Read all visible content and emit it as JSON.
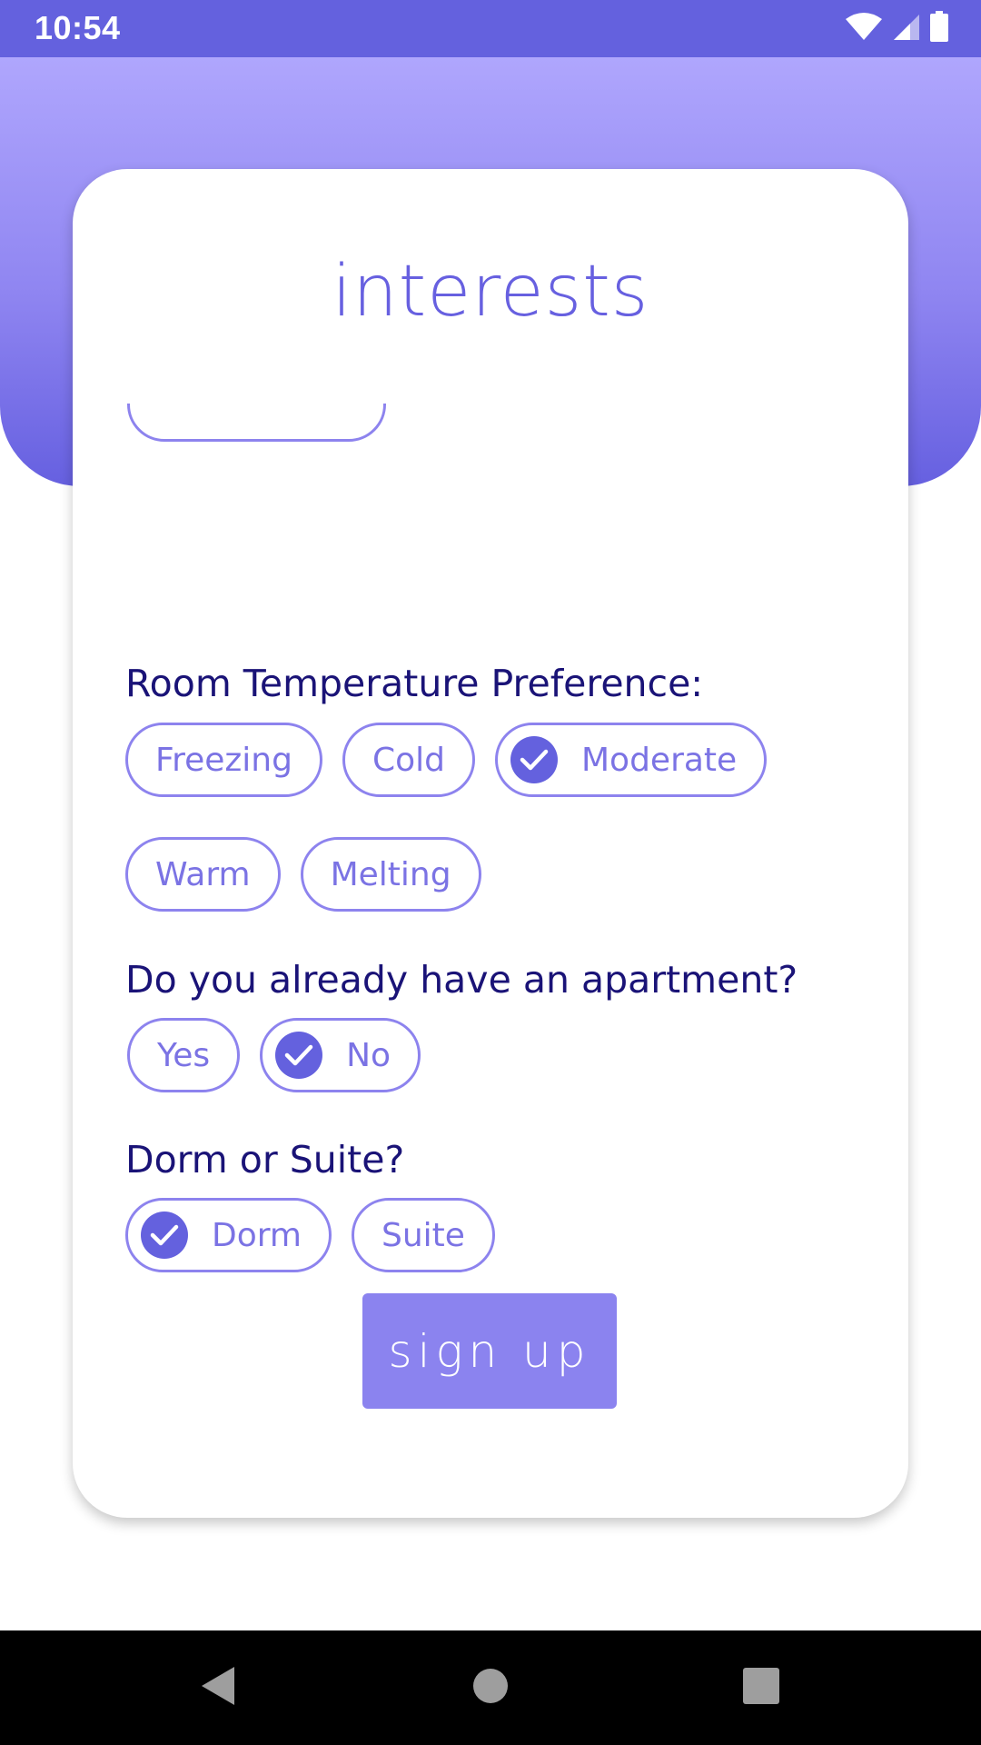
{
  "status_bar": {
    "time": "10:54",
    "icons": [
      "wifi-icon",
      "signal-icon",
      "battery-icon"
    ],
    "color": "#6461de"
  },
  "header": {
    "gradient_top": "#afa6fd",
    "gradient_bottom": "#6660e0"
  },
  "card": {
    "title": "interests"
  },
  "questions": [
    {
      "label": "Room Temperature Preference:",
      "options": [
        {
          "label": "Freezing",
          "selected": false
        },
        {
          "label": "Cold",
          "selected": false
        },
        {
          "label": "Moderate",
          "selected": true
        },
        {
          "label": "Warm",
          "selected": false
        },
        {
          "label": "Melting",
          "selected": false
        }
      ]
    },
    {
      "label": "Do you already have an apartment?",
      "options": [
        {
          "label": "Yes",
          "selected": false
        },
        {
          "label": "No",
          "selected": true
        }
      ]
    },
    {
      "label": "Dorm or Suite?",
      "options": [
        {
          "label": "Dorm",
          "selected": true
        },
        {
          "label": "Suite",
          "selected": false
        }
      ]
    }
  ],
  "signup_button": {
    "label": "sign up",
    "color": "#8b83ef"
  },
  "nav_bar": {
    "icons": [
      "back-icon",
      "home-icon",
      "recents-icon"
    ]
  }
}
